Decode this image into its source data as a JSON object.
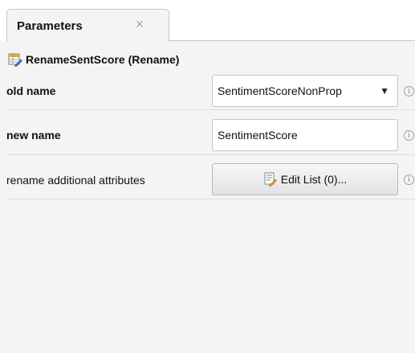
{
  "tab": {
    "label": "Parameters",
    "close_glyph": "×"
  },
  "operator": {
    "title": "RenameSentScore (Rename)",
    "icon": "rename-table-icon"
  },
  "params": [
    {
      "label": "old name",
      "value": "SentimentScoreNonProp",
      "control": "dropdown"
    },
    {
      "label": "new name",
      "value": "SentimentScore",
      "control": "text"
    },
    {
      "label": "rename additional attributes",
      "button_label": "Edit List (0)...",
      "control": "button"
    }
  ],
  "icons": {
    "info": "info-icon",
    "dropdown": "triangle-down-icon",
    "edit": "edit-list-icon"
  },
  "glyphs": {
    "info": "i",
    "dropdown": "▼"
  },
  "colors": {
    "panel_bg": "#f4f4f4",
    "border": "#c8c8c8",
    "icon_orange": "#f0a030",
    "icon_blue": "#3a7bd5"
  }
}
